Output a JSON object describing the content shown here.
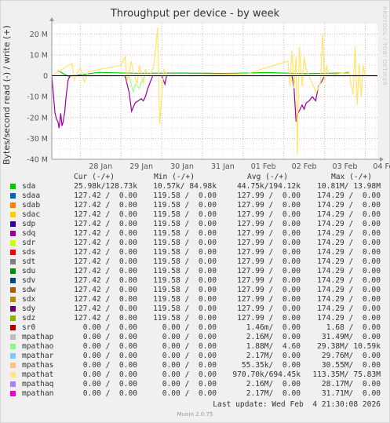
{
  "chart_data": {
    "type": "line",
    "title": "Throughput per device - by week",
    "ylabel": "Bytes/second read (-) / write (+)",
    "ylim": [
      -40000000,
      25000000
    ],
    "y_ticks": [
      {
        "value": 20000000,
        "label": "20 M"
      },
      {
        "value": 10000000,
        "label": "10 M"
      },
      {
        "value": 0,
        "label": "0"
      },
      {
        "value": -10000000,
        "label": "-10 M"
      },
      {
        "value": -20000000,
        "label": "-20 M"
      },
      {
        "value": -30000000,
        "label": "-30 M"
      },
      {
        "value": -40000000,
        "label": "-40 M"
      }
    ],
    "x_ticks": [
      "28 Jan",
      "29 Jan",
      "30 Jan",
      "31 Jan",
      "01 Feb",
      "02 Feb",
      "03 Feb",
      "04 Feb"
    ],
    "x_range_days": [
      -0.7,
      7.3
    ],
    "grid": true,
    "series": [
      {
        "name": "sda",
        "color": "#00cc00",
        "points": [
          [
            -0.55,
            2.5
          ],
          [
            -0.3,
            -0.3
          ],
          [
            0.45,
            1.6
          ],
          [
            1.35,
            1.2
          ],
          [
            2.6,
            1.3
          ],
          [
            3.55,
            1.1
          ],
          [
            4.6,
            1.5
          ],
          [
            5.55,
            1.0
          ],
          [
            6.6,
            1.4
          ]
        ]
      },
      {
        "name": "sdq",
        "color": "#990099",
        "points": [
          [
            -0.7,
            0
          ],
          [
            -0.62,
            -18
          ],
          [
            -0.58,
            -21
          ],
          [
            -0.55,
            -22
          ],
          [
            -0.52,
            -25
          ],
          [
            -0.48,
            -18
          ],
          [
            -0.45,
            -24
          ],
          [
            -0.42,
            -22
          ],
          [
            -0.38,
            -17
          ],
          [
            -0.35,
            -10
          ],
          [
            -0.3,
            -2
          ],
          [
            -0.25,
            0
          ],
          [
            1.1,
            0
          ],
          [
            1.2,
            -8
          ],
          [
            1.26,
            -17
          ],
          [
            1.3,
            -15
          ],
          [
            1.35,
            -13
          ],
          [
            1.42,
            -12
          ],
          [
            1.5,
            -11
          ],
          [
            1.55,
            -12
          ],
          [
            1.6,
            -10
          ],
          [
            1.66,
            -6
          ],
          [
            1.72,
            -3
          ],
          [
            1.78,
            0
          ],
          [
            2.0,
            0
          ],
          [
            2.08,
            -4
          ],
          [
            2.12,
            0
          ],
          [
            5.2,
            0
          ],
          [
            5.25,
            -6
          ],
          [
            5.3,
            -22
          ],
          [
            5.35,
            -18
          ],
          [
            5.4,
            -16
          ],
          [
            5.45,
            -14
          ],
          [
            5.5,
            -16
          ],
          [
            5.55,
            -13
          ],
          [
            5.62,
            -12
          ],
          [
            5.7,
            -10
          ],
          [
            5.78,
            -12
          ],
          [
            5.85,
            -5
          ],
          [
            5.95,
            -2
          ],
          [
            6.0,
            0
          ],
          [
            7.3,
            0
          ]
        ]
      },
      {
        "name": "mpathat",
        "color": "#ffe566",
        "points": [
          [
            -0.7,
            0
          ],
          [
            -0.2,
            6
          ],
          [
            -0.15,
            -2
          ],
          [
            0.0,
            4
          ],
          [
            0.1,
            -3
          ],
          [
            0.2,
            2
          ],
          [
            1.0,
            5
          ],
          [
            1.1,
            9
          ],
          [
            1.15,
            -3
          ],
          [
            1.25,
            7
          ],
          [
            1.3,
            2
          ],
          [
            1.4,
            -4
          ],
          [
            1.45,
            5
          ],
          [
            1.55,
            -4
          ],
          [
            1.6,
            3
          ],
          [
            1.7,
            0
          ],
          [
            1.8,
            4
          ],
          [
            1.9,
            23
          ],
          [
            1.95,
            -23
          ],
          [
            2.05,
            3
          ],
          [
            2.15,
            0
          ],
          [
            4.1,
            1
          ],
          [
            5.1,
            7
          ],
          [
            5.15,
            -5
          ],
          [
            5.2,
            12
          ],
          [
            5.25,
            -6
          ],
          [
            5.3,
            9
          ],
          [
            5.33,
            -38
          ],
          [
            5.38,
            14
          ],
          [
            5.45,
            -5
          ],
          [
            5.5,
            9
          ],
          [
            5.55,
            3
          ],
          [
            5.8,
            -8
          ],
          [
            5.9,
            -3
          ],
          [
            5.95,
            20
          ],
          [
            6.0,
            -3
          ],
          [
            6.05,
            5
          ],
          [
            6.1,
            0
          ],
          [
            6.6,
            2
          ],
          [
            6.7,
            -9
          ],
          [
            6.75,
            14
          ],
          [
            6.8,
            -14
          ],
          [
            6.85,
            6
          ],
          [
            6.9,
            -10
          ],
          [
            6.95,
            5
          ],
          [
            7.0,
            0
          ],
          [
            7.3,
            0
          ]
        ]
      },
      {
        "name": "mpathao",
        "color": "#99ff99",
        "points": [
          [
            1.2,
            0
          ],
          [
            1.3,
            -8
          ],
          [
            1.35,
            -4
          ],
          [
            1.45,
            -6
          ],
          [
            1.5,
            -3
          ],
          [
            1.6,
            0
          ]
        ]
      }
    ],
    "legend_headers": [
      "Cur (-/+)",
      "Min (-/+)",
      "Avg (-/+)",
      "Max (-/+)"
    ],
    "legend": [
      {
        "name": "sda",
        "color": "#00cc00",
        "cur": "25.98k/128.73k",
        "min": "10.57k/ 84.98k",
        "avg": "44.75k/194.12k",
        "max": "10.81M/ 13.98M"
      },
      {
        "name": "sdaa",
        "color": "#0066b3",
        "cur": "127.42 /  0.00",
        "min": "119.58 /  0.00",
        "avg": "127.99 /  0.00",
        "max": "174.29 /  0.00"
      },
      {
        "name": "sdab",
        "color": "#ff8000",
        "cur": "127.42 /  0.00",
        "min": "119.58 /  0.00",
        "avg": "127.99 /  0.00",
        "max": "174.29 /  0.00"
      },
      {
        "name": "sdac",
        "color": "#ffcc00",
        "cur": "127.42 /  0.00",
        "min": "119.58 /  0.00",
        "avg": "127.99 /  0.00",
        "max": "174.29 /  0.00"
      },
      {
        "name": "sdp",
        "color": "#330099",
        "cur": "127.42 /  0.00",
        "min": "119.58 /  0.00",
        "avg": "127.99 /  0.00",
        "max": "174.29 /  0.00"
      },
      {
        "name": "sdq",
        "color": "#990099",
        "cur": "127.42 /  0.00",
        "min": "119.58 /  0.00",
        "avg": "127.99 /  0.00",
        "max": "174.29 /  0.00"
      },
      {
        "name": "sdr",
        "color": "#ccff00",
        "cur": "127.42 /  0.00",
        "min": "119.58 /  0.00",
        "avg": "127.99 /  0.00",
        "max": "174.29 /  0.00"
      },
      {
        "name": "sds",
        "color": "#ff0000",
        "cur": "127.42 /  0.00",
        "min": "119.58 /  0.00",
        "avg": "127.99 /  0.00",
        "max": "174.29 /  0.00"
      },
      {
        "name": "sdt",
        "color": "#808080",
        "cur": "127.42 /  0.00",
        "min": "119.58 /  0.00",
        "avg": "127.99 /  0.00",
        "max": "174.29 /  0.00"
      },
      {
        "name": "sdu",
        "color": "#008f00",
        "cur": "127.42 /  0.00",
        "min": "119.58 /  0.00",
        "avg": "127.99 /  0.00",
        "max": "174.29 /  0.00"
      },
      {
        "name": "sdv",
        "color": "#00487d",
        "cur": "127.42 /  0.00",
        "min": "119.58 /  0.00",
        "avg": "127.99 /  0.00",
        "max": "174.29 /  0.00"
      },
      {
        "name": "sdw",
        "color": "#b35a00",
        "cur": "127.42 /  0.00",
        "min": "119.58 /  0.00",
        "avg": "127.99 /  0.00",
        "max": "174.29 /  0.00"
      },
      {
        "name": "sdx",
        "color": "#b38f00",
        "cur": "127.42 /  0.00",
        "min": "119.58 /  0.00",
        "avg": "127.99 /  0.00",
        "max": "174.29 /  0.00"
      },
      {
        "name": "sdy",
        "color": "#6b006b",
        "cur": "127.42 /  0.00",
        "min": "119.58 /  0.00",
        "avg": "127.99 /  0.00",
        "max": "174.29 /  0.00"
      },
      {
        "name": "sdz",
        "color": "#8fb300",
        "cur": "127.42 /  0.00",
        "min": "119.58 /  0.00",
        "avg": "127.99 /  0.00",
        "max": "174.29 /  0.00"
      },
      {
        "name": "sr0",
        "color": "#b30000",
        "cur": "0.00 /  0.00",
        "min": "0.00 /  0.00",
        "avg": "1.46m/  0.00",
        "max": "1.68 /  0.00"
      },
      {
        "name": "mpathap",
        "color": "#bebebe",
        "cur": "0.00 /  0.00",
        "min": "0.00 /  0.00",
        "avg": "2.16M/  0.00",
        "max": "31.49M/  0.00"
      },
      {
        "name": "mpathao",
        "color": "#80ff80",
        "cur": "0.00 /  0.00",
        "min": "0.00 /  0.00",
        "avg": "1.88M/  4.60",
        "max": "29.38M/ 10.59k"
      },
      {
        "name": "mpathar",
        "color": "#80c9ff",
        "cur": "0.00 /  0.00",
        "min": "0.00 /  0.00",
        "avg": "2.17M/  0.00",
        "max": "29.76M/  0.00"
      },
      {
        "name": "mpathas",
        "color": "#ffc080",
        "cur": "0.00 /  0.00",
        "min": "0.00 /  0.00",
        "avg": "55.35k/  0.00",
        "max": "30.55M/  0.00"
      },
      {
        "name": "mpathat",
        "color": "#ffe680",
        "cur": "0.00 /  0.00",
        "min": "0.00 /  0.00",
        "avg": "970.70k/694.45k",
        "max": "113.35M/ 75.83M"
      },
      {
        "name": "mpathaq",
        "color": "#aa80ff",
        "cur": "0.00 /  0.00",
        "min": "0.00 /  0.00",
        "avg": "2.16M/  0.00",
        "max": "28.17M/  0.00"
      },
      {
        "name": "mpathan",
        "color": "#ee00cc",
        "cur": "0.00 /  0.00",
        "min": "0.00 /  0.00",
        "avg": "2.17M/  0.00",
        "max": "31.71M/  0.00"
      }
    ],
    "last_update": "Last update: Wed Feb  4 21:30:08 2026"
  },
  "side_label": "RRDTOOL / TOBI OETIKER",
  "footer": "Munin 2.0.75"
}
